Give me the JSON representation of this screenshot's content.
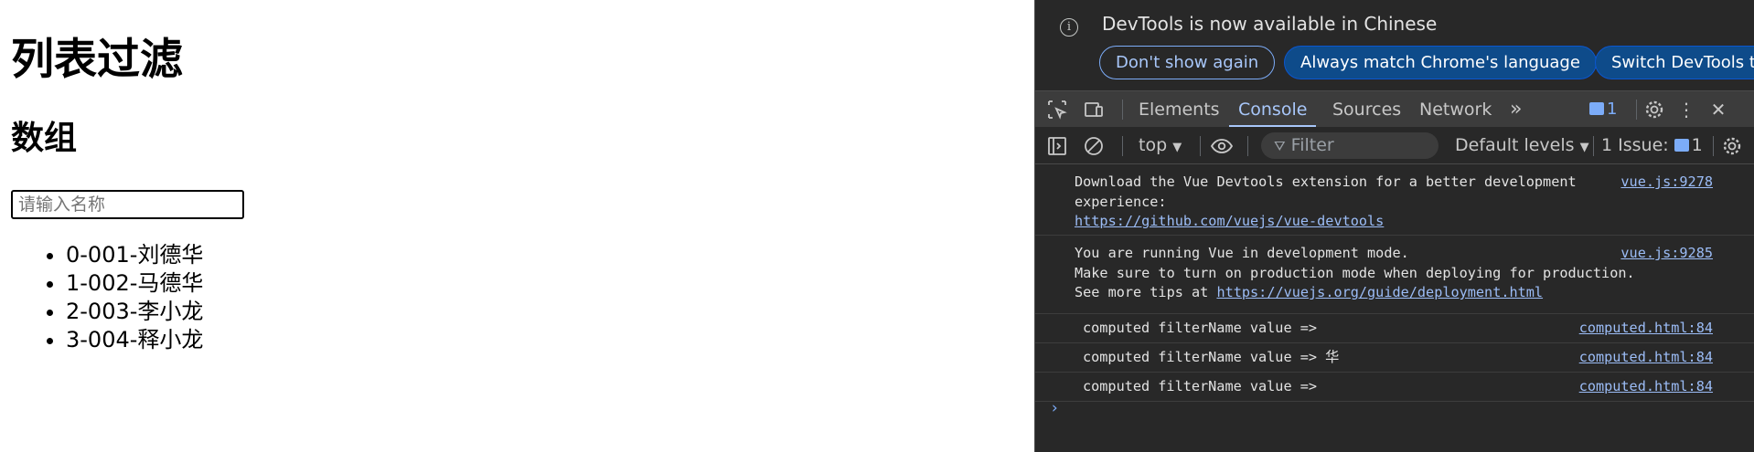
{
  "page": {
    "title": "列表过滤",
    "subtitle": "数组",
    "search_placeholder": "请输入名称",
    "items": [
      "0-001-刘德华",
      "1-002-马德华",
      "2-003-李小龙",
      "3-004-释小龙"
    ]
  },
  "devtools": {
    "infobar": {
      "message": "DevTools is now available in Chinese",
      "btn_dont_show": "Don't show again",
      "btn_match_language": "Always match Chrome's language",
      "btn_switch": "Switch DevTools to Chinese"
    },
    "tabs": [
      "Elements",
      "Console",
      "Sources",
      "Network"
    ],
    "active_tab": "Console",
    "more_tabs": "»",
    "message_badge": "1",
    "toolbar": {
      "context": "top",
      "filter_placeholder": "Filter",
      "levels": "Default levels",
      "issues_label": "1 Issue:",
      "issues_count": "1"
    },
    "messages": [
      {
        "lines": [
          "Download the Vue Devtools extension for a better development",
          "experience:"
        ],
        "link": "https://github.com/vuejs/vue-devtools",
        "source": "vue.js:9278"
      },
      {
        "lines": [
          "You are running Vue in development mode.",
          "Make sure to turn on production mode when deploying for production.",
          "See more tips at "
        ],
        "link": "https://vuejs.org/guide/deployment.html",
        "source": "vue.js:9285"
      },
      {
        "text": "computed filterName value =>",
        "source": "computed.html:84"
      },
      {
        "text": "computed filterName value => 华",
        "source": "computed.html:84"
      },
      {
        "text": "computed filterName value =>",
        "source": "computed.html:84"
      }
    ],
    "colors": {
      "panel_bg": "#282828",
      "tabbar_bg": "#3c3c3c",
      "accent": "#a8c7fa",
      "link": "#9cbdf7"
    }
  }
}
